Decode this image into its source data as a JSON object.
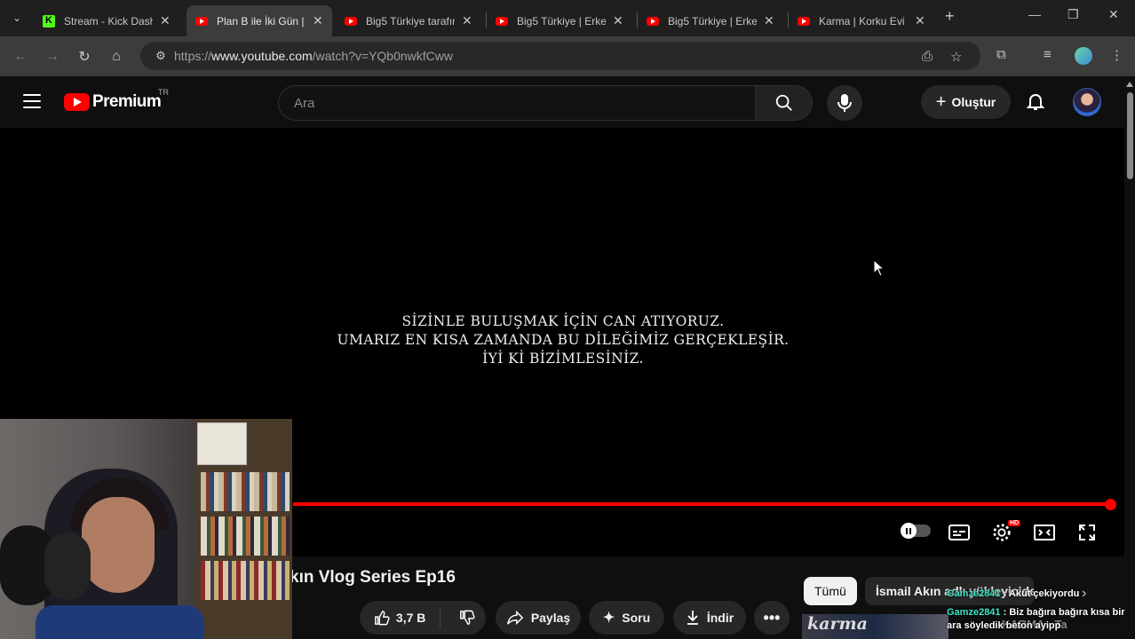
{
  "browser": {
    "tabs": [
      {
        "title": "Stream - Kick Dash",
        "icon": "kick-icon",
        "active": false
      },
      {
        "title": "Plan B ile İki Gün |",
        "icon": "youtube-icon",
        "active": true
      },
      {
        "title": "Big5 Türkiye tarafın",
        "icon": "youtube-icon",
        "active": false
      },
      {
        "title": "Big5 Türkiye | Erke",
        "icon": "youtube-icon",
        "active": false
      },
      {
        "title": "Big5 Türkiye | Erke",
        "icon": "youtube-icon",
        "active": false
      },
      {
        "title": "Karma | Korku Evi |",
        "icon": "youtube-icon",
        "active": false
      }
    ],
    "url_prefix": "https://",
    "url_host": "www.youtube.com",
    "url_path": "/watch?v=YQb0nwkfCww"
  },
  "youtube": {
    "logo_text": "Premium",
    "country_code": "TR",
    "search_placeholder": "Ara",
    "create_label": "Oluştur"
  },
  "player": {
    "subtitle_lines": [
      "SİZİNLE BULUŞMAK İÇİN CAN ATIYORUZ.",
      "UMARIZ EN KISA ZAMANDA BU DİLEĞİMİZ GERÇEKLEŞİR.",
      "İYİ Kİ BİZİMLESİNİZ."
    ],
    "progress_percent": 100,
    "hd_badge": "HD"
  },
  "video": {
    "title": "kın Vlog Series Ep16",
    "likes": "3,7 B",
    "share_label": "Paylaş",
    "ask_label": "Soru",
    "download_label": "İndir"
  },
  "recommendations": {
    "chip_all": "Tümü",
    "chip_uploader": "İsmail Akın adlı yükleyiciden",
    "next_thumb_text": "karma",
    "next_title": "KARMA - Ta"
  },
  "chat": [
    {
      "user": "Gamze2841",
      "message": "Akut çekiyordu"
    },
    {
      "user": "Gamze2841",
      "message": "Biz bağıra bağıra kısa bir ara söyledik beton ayipp"
    }
  ],
  "colors": {
    "accent_red": "#ff0000",
    "chat_user": "#3ee6c8",
    "kick_green": "#53fc18"
  }
}
